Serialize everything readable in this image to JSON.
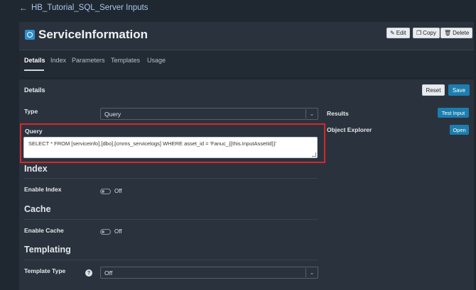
{
  "nav": {
    "back_label": "HB_Tutorial_SQL_Server Inputs",
    "back_icon": "arrow-left-icon"
  },
  "header": {
    "title": "ServiceInformation",
    "edit_label": "Edit",
    "copy_label": "Copy",
    "delete_label": "Delete"
  },
  "tabs": [
    {
      "label": "Details",
      "active": true
    },
    {
      "label": "Index"
    },
    {
      "label": "Parameters"
    },
    {
      "label": "Templates"
    },
    {
      "label": "Usage"
    }
  ],
  "details": {
    "section_title": "Details",
    "reset_label": "Reset",
    "save_label": "Save",
    "type_label": "Type",
    "type_value": "Query",
    "query_label": "Query",
    "query_value": "SELECT * FROM [serviceinfo].[dbo].[cmms_servicelogs] WHERE asset_id = 'Fanuc_{{this.InputAssetId}}'"
  },
  "index": {
    "title": "Index",
    "enable_label": "Enable Index",
    "state": "Off"
  },
  "cache": {
    "title": "Cache",
    "enable_label": "Enable Cache",
    "state": "Off"
  },
  "templating": {
    "title": "Templating",
    "type_label": "Template Type",
    "type_value": "Off",
    "help": "?"
  },
  "side": {
    "results_label": "Results",
    "test_input_label": "Test Input",
    "object_explorer_label": "Object Explorer",
    "open_label": "Open"
  },
  "colors": {
    "accent": "#1c7eae",
    "highlight": "#d62828",
    "background": "#1f2730",
    "panel": "#2a333d"
  }
}
